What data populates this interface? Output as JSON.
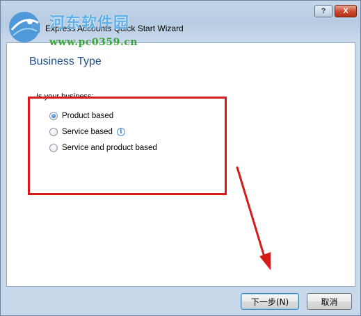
{
  "window": {
    "title": "Express Accounts Quick Start Wizard",
    "help_label": "?",
    "close_label": "X"
  },
  "watermark": {
    "site_name": "河东软件园",
    "url": "www.pc0359.cn"
  },
  "page": {
    "heading": "Business Type",
    "question": "Is your business:",
    "options": [
      {
        "label": "Product based",
        "selected": true
      },
      {
        "label": "Service based",
        "selected": false,
        "info_icon": "info-icon"
      },
      {
        "label": "Service and product based",
        "selected": false
      }
    ],
    "info_glyph": "i"
  },
  "footer": {
    "next_label": "下一步(N)",
    "cancel_label": "取消"
  },
  "colors": {
    "heading": "#1d4d8c",
    "highlight": "#d61a1a",
    "watermark_text": "#5fb0e6",
    "watermark_url": "#3aa33a"
  }
}
